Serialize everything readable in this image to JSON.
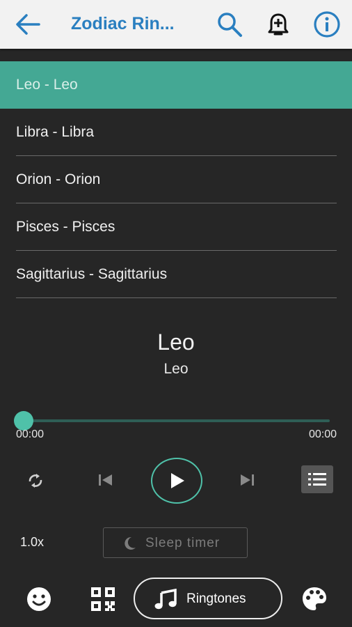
{
  "app_bar": {
    "title": "Zodiac Rin...",
    "back_icon": "arrow-left-icon",
    "search_icon": "search-icon",
    "add_alarm_icon": "bell-plus-icon",
    "info_icon": "info-icon",
    "accent": "#2a7fc0"
  },
  "playlist": {
    "items": [
      {
        "label": "Leo - Leo",
        "active": true
      },
      {
        "label": "Libra - Libra"
      },
      {
        "label": "Orion - Orion"
      },
      {
        "label": "Pisces - Pisces"
      },
      {
        "label": "Sagittarius - Sagittarius"
      }
    ],
    "active_color": "#44a894"
  },
  "now_playing": {
    "title": "Leo",
    "artist": "Leo",
    "elapsed": "00:00",
    "duration": "00:00",
    "progress": 0
  },
  "controls": {
    "repeat_icon": "repeat-icon",
    "previous_icon": "skip-previous-icon",
    "play_icon": "play-icon",
    "next_icon": "skip-next-icon",
    "queue_icon": "list-icon",
    "speed": "1.0x",
    "sleep_timer_label": "Sleep timer",
    "sleep_icon": "moon-icon"
  },
  "bottom_nav": {
    "emoji_icon": "smiley-icon",
    "qr_icon": "qr-code-icon",
    "ringtones_label": "Ringtones",
    "ringtones_icon": "music-note-icon",
    "palette_icon": "palette-icon"
  }
}
